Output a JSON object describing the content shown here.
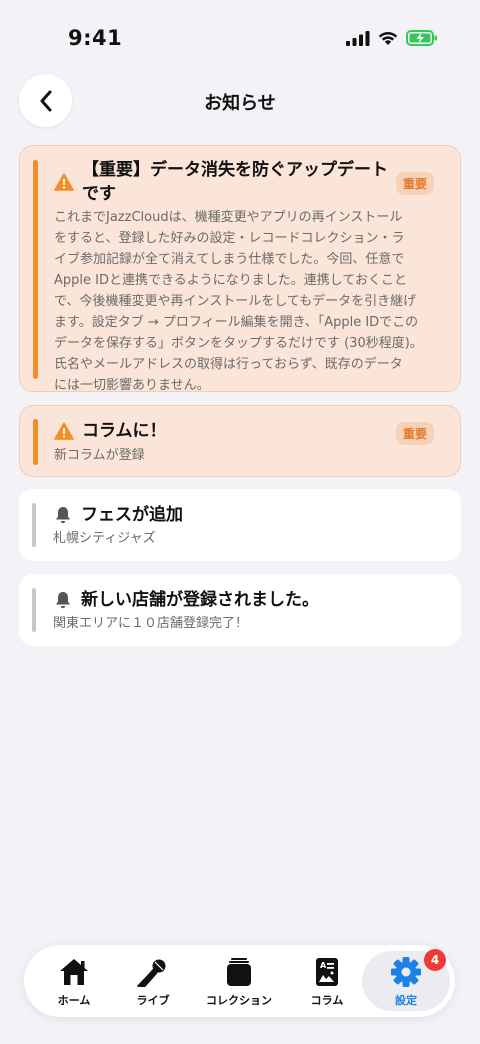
{
  "status_bar": {
    "time": "9:41"
  },
  "header": {
    "title": "お知らせ"
  },
  "notices": [
    {
      "title_line1": "【重要】データ消失を防ぐアップデート",
      "title_line2": "です",
      "badge": "重要",
      "body_lines": [
        "これまでJazzCloudは、機種変更やアプリの再インストール",
        "をすると、登録した好みの設定・レコードコレクション・ラ",
        "イブ参加記録が全て消えてしまう仕様でした。今回、任意で",
        "Apple IDと連携できるようになりました。連携しておくこと",
        "で、今後機種変更や再インストールをしてもデータを引き継げ",
        "ます。設定タブ → プロフィール編集を開き、「Apple IDでこの",
        "データを保存する」ボタンをタップするだけです (30秒程度)。",
        "氏名やメールアドレスの取得は行っておらず、既存のデータ",
        "には一切影響ありません。"
      ]
    },
    {
      "title": "コラムに！",
      "badge": "重要",
      "body": "新コラムが登録"
    },
    {
      "title": "フェスが追加",
      "body": "札幌シティジャズ"
    },
    {
      "title": "新しい店舗が登録されました。",
      "body": "関東エリアに１０店舗登録完了！"
    }
  ],
  "tabbar": {
    "home": "ホーム",
    "live": "ライブ",
    "collection": "コレクション",
    "column": "コラム",
    "settings": "設定",
    "settings_badge": "4"
  },
  "colors": {
    "accent": "#f28d28",
    "active_tab": "#1a82e6",
    "badge_red": "#f03a3a"
  }
}
